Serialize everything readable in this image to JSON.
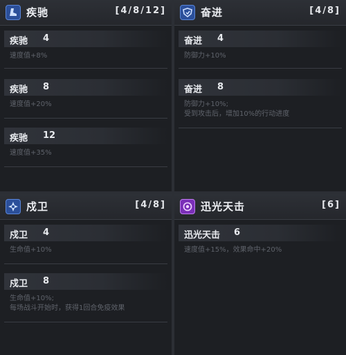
{
  "panels": {
    "jichi": {
      "title": "疾驰",
      "tiers_label": "[4/8/12]",
      "icon": "boot-icon",
      "tiers": [
        {
          "name": "疾驰",
          "level": "4",
          "effect": "速度值+8%"
        },
        {
          "name": "疾驰",
          "level": "8",
          "effect": "速度值+20%"
        },
        {
          "name": "疾驰",
          "level": "12",
          "effect": "速度值+35%"
        }
      ]
    },
    "fenjin": {
      "title": "奋进",
      "tiers_label": "[4/8]",
      "icon": "shield-icon",
      "tiers": [
        {
          "name": "奋进",
          "level": "4",
          "effect": "防御力+10%"
        },
        {
          "name": "奋进",
          "level": "8",
          "effect": "防御力+10%;",
          "effect2": "受到攻击后，增加10%的行动进度"
        }
      ]
    },
    "shuwei": {
      "title": "戍卫",
      "tiers_label": "[4/8]",
      "icon": "guard-icon",
      "tiers": [
        {
          "name": "戍卫",
          "level": "4",
          "effect": "生命值+10%"
        },
        {
          "name": "戍卫",
          "level": "8",
          "effect": "生命值+10%;",
          "effect2": "每场战斗开始时，获得1回合免疫效果"
        }
      ]
    },
    "xunguang": {
      "title": "迅光天击",
      "tiers_label": "[6]",
      "icon": "orb-icon",
      "tiers": [
        {
          "name": "迅光天击",
          "level": "6",
          "effect": "速度值+15%，效果命中+20%"
        }
      ]
    }
  },
  "colors": {
    "panel_bg": "#1d1f23",
    "header_bg": "#2d3036",
    "muted_text": "#5f636b",
    "icon_blue": "#2b4f9a",
    "icon_purple": "#7a2fb8"
  }
}
